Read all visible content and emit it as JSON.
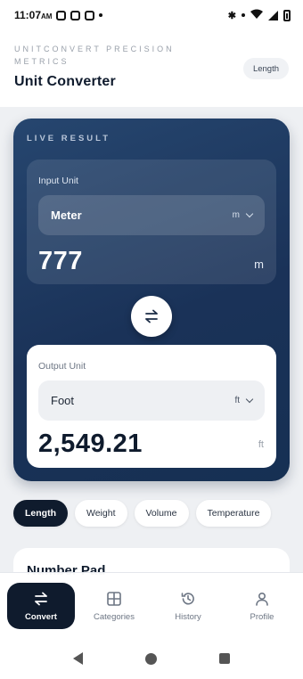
{
  "status_bar": {
    "time": "11:07",
    "ampm": "AM"
  },
  "header": {
    "eyebrow": "UNITCONVERT PRECISION METRICS",
    "title": "Unit Converter",
    "category_chip": "Length"
  },
  "result": {
    "live_label": "LIVE RESULT",
    "input": {
      "label": "Input Unit",
      "unit_name": "Meter",
      "unit_symbol": "m",
      "value": "777",
      "value_unit": "m"
    },
    "output": {
      "label": "Output Unit",
      "unit_name": "Foot",
      "unit_symbol": "ft",
      "value": "2,549.21",
      "value_unit": "ft"
    }
  },
  "categories": [
    {
      "label": "Length",
      "active": true
    },
    {
      "label": "Weight",
      "active": false
    },
    {
      "label": "Volume",
      "active": false
    },
    {
      "label": "Temperature",
      "active": false
    }
  ],
  "number_pad": {
    "title": "Number Pad"
  },
  "bottom_nav": [
    {
      "label": "Convert",
      "icon": "swap-icon",
      "active": true
    },
    {
      "label": "Categories",
      "icon": "grid-icon",
      "active": false
    },
    {
      "label": "History",
      "icon": "history-icon",
      "active": false
    },
    {
      "label": "Profile",
      "icon": "person-icon",
      "active": false
    }
  ],
  "colors": {
    "primary_dark": "#0f1b2d",
    "card_gradient_start": "#26466f",
    "card_gradient_end": "#163053",
    "background": "#eef0f3"
  }
}
